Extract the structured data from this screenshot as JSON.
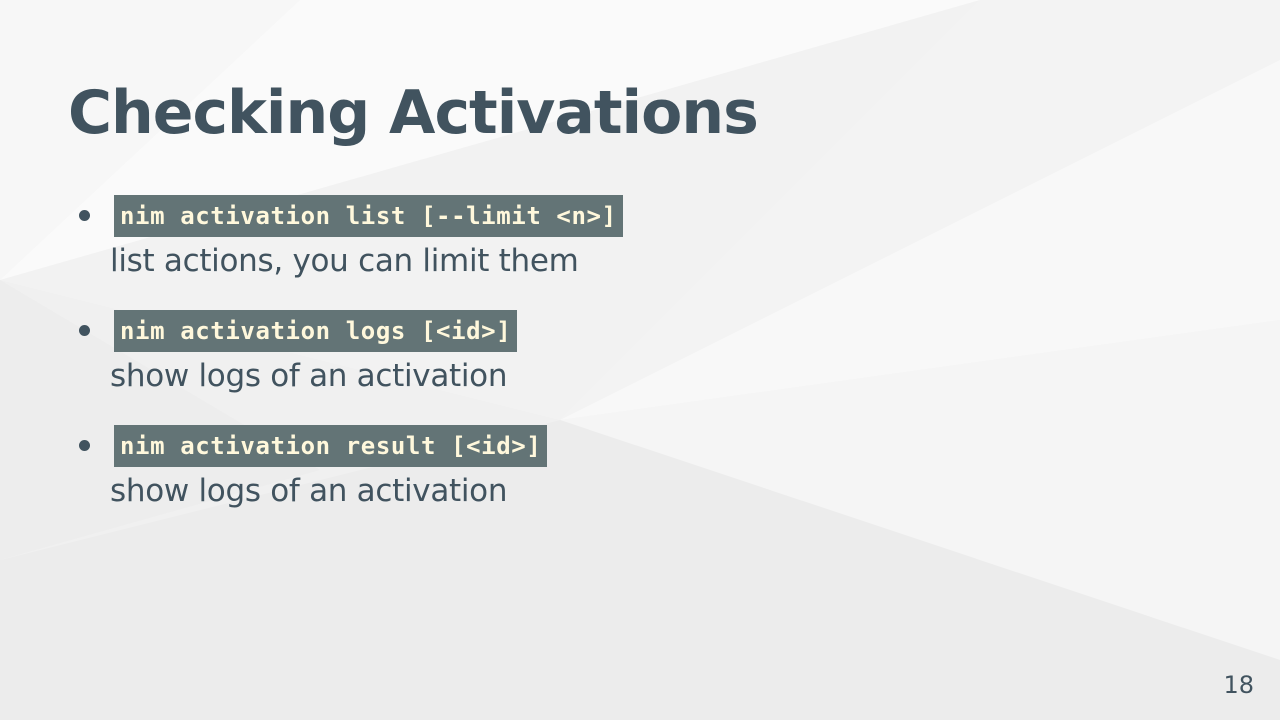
{
  "slide": {
    "title": "Checking Activations",
    "bullets": [
      {
        "command": "nim activation list [--limit <n>]",
        "description": "list actions, you can limit them"
      },
      {
        "command": "nim activation logs [<id>]",
        "description": "show logs of an activation"
      },
      {
        "command": "nim activation result [<id>]",
        "description": "show logs of an activation"
      }
    ],
    "page_number": "18"
  },
  "colors": {
    "title_text": "#41535f",
    "code_background": "#637476",
    "code_text": "#fff8dc",
    "background": "#f2f2f2"
  }
}
